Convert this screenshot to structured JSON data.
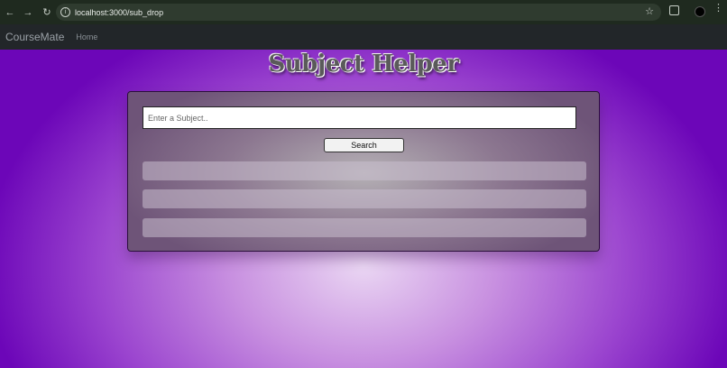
{
  "browser": {
    "url": "localhost:3000/sub_drop",
    "icons": {
      "back": "arrow-left-icon",
      "forward": "arrow-right-icon",
      "reload": "reload-icon",
      "info": "info-icon",
      "bookmark": "star-icon",
      "extensions": "extension-icon",
      "menu": "kebab-menu-icon"
    }
  },
  "navbar": {
    "brand": "CourseMate",
    "links": [
      {
        "label": "Home"
      }
    ]
  },
  "main": {
    "title": "Subject Helper",
    "search": {
      "placeholder": "Enter a Subject..",
      "value": "",
      "button_label": "Search"
    },
    "results": [
      {},
      {},
      {}
    ]
  },
  "colors": {
    "navbar_bg": "#222629",
    "background_edge": "#6c06b8",
    "background_center": "#ead6f3",
    "card_border": "#2b0f3b"
  }
}
